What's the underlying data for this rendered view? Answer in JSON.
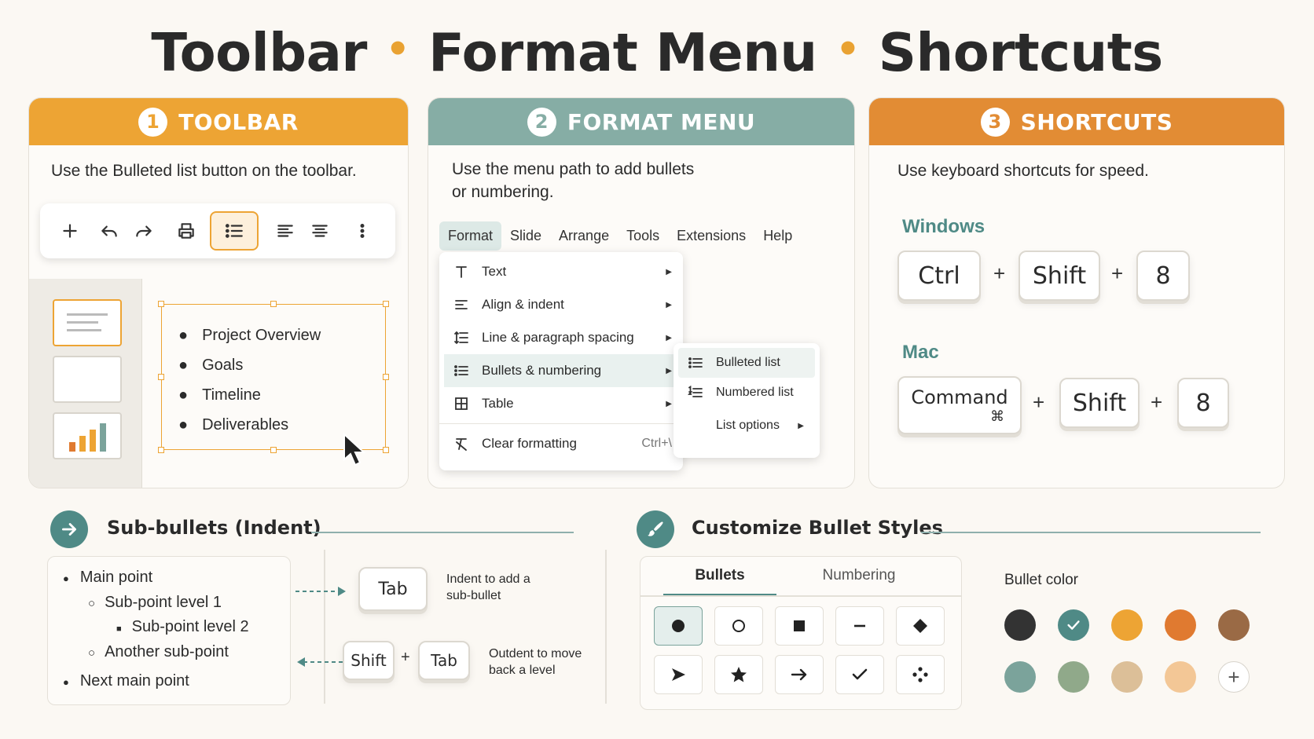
{
  "title": {
    "part1": "Toolbar",
    "part2": "Format Menu",
    "part3": "Shortcuts",
    "separator": "•"
  },
  "colors": {
    "toolbar_header": "#eda434",
    "format_header": "#86ada5",
    "shortcuts_header": "#e28c34",
    "teal": "#4f8a86",
    "accent_orange": "#e9a232"
  },
  "toolbar_panel": {
    "number": "1",
    "header": "TOOLBAR",
    "description": "Use the Bulleted list button on the toolbar.",
    "icons": [
      "add-icon",
      "undo-icon",
      "redo-icon",
      "print-icon",
      "bulleted-list-icon",
      "align-left-icon",
      "align-center-icon",
      "more-icon"
    ],
    "slide_bullets": [
      "Project Overview",
      "Goals",
      "Timeline",
      "Deliverables"
    ]
  },
  "format_panel": {
    "number": "2",
    "header": "FORMAT MENU",
    "description_line1": "Use the menu path to add bullets",
    "description_line2": "or numbering.",
    "menubar": [
      "Format",
      "Slide",
      "Arrange",
      "Tools",
      "Extensions",
      "Help"
    ],
    "menu_items": [
      {
        "label": "Text",
        "icon": "text-icon"
      },
      {
        "label": "Align & indent",
        "icon": "align-indent-icon"
      },
      {
        "label": "Line & paragraph spacing",
        "icon": "line-spacing-icon"
      },
      {
        "label": "Bullets & numbering",
        "icon": "bullets-icon"
      },
      {
        "label": "Table",
        "icon": "table-icon"
      },
      {
        "label": "Clear formatting",
        "icon": "clear-format-icon",
        "shortcut": "Ctrl+\\"
      }
    ],
    "submenu": [
      "Bulleted list",
      "Numbered list",
      "List options"
    ]
  },
  "shortcuts_panel": {
    "number": "3",
    "header": "SHORTCUTS",
    "description": "Use keyboard shortcuts for speed.",
    "windows_label": "Windows",
    "windows_keys": [
      "Ctrl",
      "Shift",
      "8"
    ],
    "mac_label": "Mac",
    "mac_keys": [
      "Command",
      "Shift",
      "8"
    ],
    "mac_symbol": "⌘",
    "plus": "+"
  },
  "subbullets": {
    "title": "Sub-bullets (Indent)",
    "items": [
      "Main point",
      "Sub-point level 1",
      "Sub-point level 2",
      "Another sub-point",
      "Next main point"
    ],
    "tab_key": "Tab",
    "indent_text_1": "Indent to add a",
    "indent_text_2": "sub-bullet",
    "shift_key": "Shift",
    "outdent_text_1": "Outdent to move",
    "outdent_text_2": "back a level"
  },
  "customize": {
    "title": "Customize Bullet Styles",
    "tabs": [
      "Bullets",
      "Numbering"
    ],
    "bullet_styles": [
      "filled-circle",
      "hollow-circle",
      "filled-square",
      "dash",
      "diamond",
      "arrowhead",
      "star",
      "arrow",
      "checkmark",
      "four-dots"
    ],
    "color_label": "Bullet color",
    "swatches": [
      "#333333",
      "#4f8a86",
      "#eda434",
      "#e07a30",
      "#9a6a45",
      "#7ba39b",
      "#90a98a",
      "#dcbf98",
      "#f3c796"
    ]
  }
}
